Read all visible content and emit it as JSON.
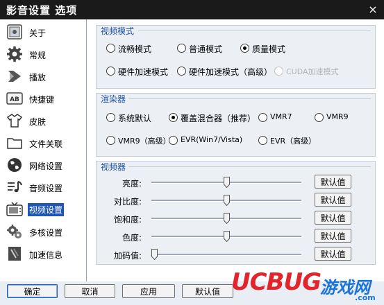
{
  "window": {
    "title": "影音设置 选项",
    "close_glyph": "×"
  },
  "sidebar": {
    "items": [
      {
        "label": "关于",
        "icon": "info-icon"
      },
      {
        "label": "常规",
        "icon": "gear-icon"
      },
      {
        "label": "播放",
        "icon": "play-icon"
      },
      {
        "label": "快捷键",
        "icon": "keyboard-icon"
      },
      {
        "label": "皮肤",
        "icon": "shirt-icon"
      },
      {
        "label": "文件关联",
        "icon": "folder-icon"
      },
      {
        "label": "网络设置",
        "icon": "globe-icon"
      },
      {
        "label": "音频设置",
        "icon": "music-icon"
      },
      {
        "label": "视频设置",
        "icon": "tv-icon",
        "selected": true
      },
      {
        "label": "多核设置",
        "icon": "multicore-icon"
      },
      {
        "label": "加速信息",
        "icon": "accelerate-icon"
      }
    ]
  },
  "video_mode": {
    "title": "视频模式",
    "options": [
      {
        "label": "流畅模式",
        "checked": false,
        "enabled": true
      },
      {
        "label": "普通模式",
        "checked": false,
        "enabled": true
      },
      {
        "label": "质量模式",
        "checked": true,
        "enabled": true
      },
      {
        "label": "硬件加速模式",
        "checked": false,
        "enabled": true
      },
      {
        "label": "硬件加速模式（高级）",
        "checked": false,
        "enabled": true
      },
      {
        "label": "CUDA加速模式",
        "checked": false,
        "enabled": false
      }
    ]
  },
  "renderer": {
    "title": "渲染器",
    "options": [
      {
        "label": "系统默认",
        "checked": false
      },
      {
        "label": "覆盖混合器（推荐）",
        "checked": true
      },
      {
        "label": "VMR7",
        "checked": false
      },
      {
        "label": "VMR9",
        "checked": false
      },
      {
        "label": "VMR9（高级）",
        "checked": false
      },
      {
        "label": "EVR(Win7/Vista)",
        "checked": false
      },
      {
        "label": "EVR（高级）",
        "checked": false
      }
    ]
  },
  "video_adjust": {
    "title": "视频器",
    "rows": [
      {
        "label": "亮度:",
        "level": 0.5,
        "reset_label": "默认值"
      },
      {
        "label": "对比度:",
        "level": 0.5,
        "reset_label": "默认值"
      },
      {
        "label": "饱和度:",
        "level": 0.5,
        "reset_label": "默认值"
      },
      {
        "label": "色度:",
        "level": 0.5,
        "reset_label": "默认值"
      },
      {
        "label": "加码值:",
        "level": 0.0,
        "reset_label": "默认值"
      }
    ]
  },
  "footer": {
    "ok_label": "确定",
    "cancel_label": "取消",
    "apply_label": "应用",
    "default_label": "默认值"
  },
  "watermark": {
    "brand": "UCBUG",
    "tagline": "游戏网",
    "domain": ".com"
  },
  "colors": {
    "selection": "#1f56b3",
    "panel_title": "#1a4fa0",
    "titlebar": "#1a1a1a",
    "brand_red": "#e3242b",
    "brand_blue": "#1a73d9"
  }
}
